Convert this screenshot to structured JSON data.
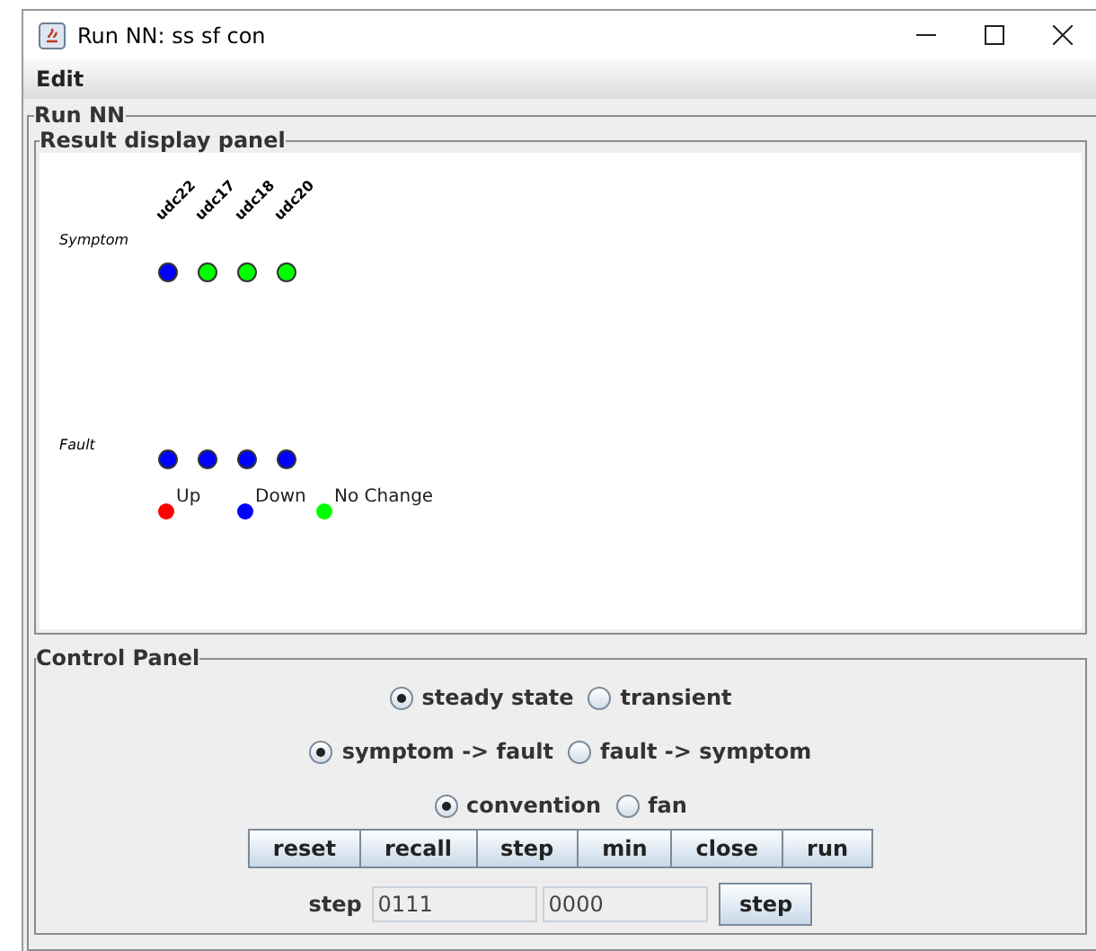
{
  "window": {
    "title": "Run NN: ss sf con"
  },
  "menu": [
    "Edit"
  ],
  "run_panel": {
    "title": "Run NN"
  },
  "result_panel": {
    "title": "Result display panel",
    "symptom_label": "Symptom",
    "fault_label": "Fault",
    "columns": [
      "udc22",
      "udc17",
      "udc18",
      "udc20"
    ],
    "symptom_dots": [
      {
        "color": "#0000ff"
      },
      {
        "color": "#00ff00"
      },
      {
        "color": "#00ff00"
      },
      {
        "color": "#00ff00"
      }
    ],
    "fault_dots": [
      {
        "color": "#0000ff"
      },
      {
        "color": "#0000ff"
      },
      {
        "color": "#0000ff"
      },
      {
        "color": "#0000ff"
      }
    ],
    "legend": [
      {
        "label": "Up",
        "color": "#ff0000"
      },
      {
        "label": "Down",
        "color": "#0000ff"
      },
      {
        "label": "No Change",
        "color": "#00ff00"
      }
    ]
  },
  "control_panel": {
    "title": "Control Panel",
    "radio_groups": [
      [
        {
          "label": "steady state",
          "selected": true
        },
        {
          "label": "transient",
          "selected": false
        }
      ],
      [
        {
          "label": "symptom -> fault",
          "selected": true
        },
        {
          "label": "fault -> symptom",
          "selected": false
        }
      ],
      [
        {
          "label": "convention",
          "selected": true
        },
        {
          "label": "fan",
          "selected": false
        }
      ]
    ],
    "buttons": [
      "reset",
      "recall",
      "step",
      "min",
      "close",
      "run"
    ],
    "step_row": {
      "label": "step",
      "field_1": "0111",
      "field_2": "0000",
      "button": "step"
    }
  }
}
